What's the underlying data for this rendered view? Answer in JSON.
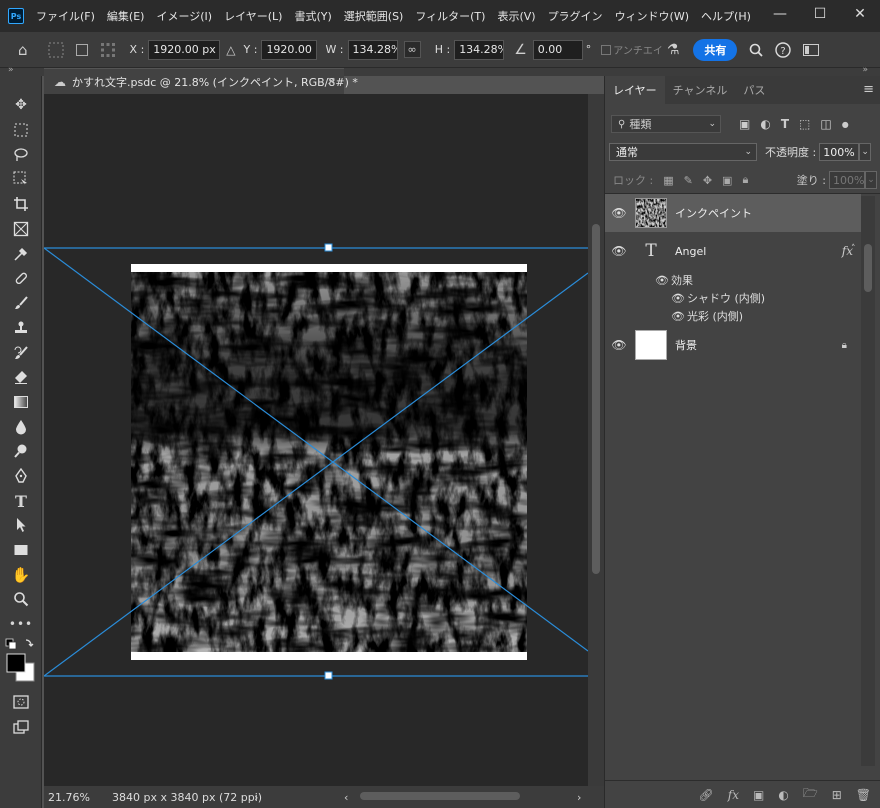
{
  "app": {
    "logo": "Ps",
    "menu": [
      "ファイル(F)",
      "編集(E)",
      "イメージ(I)",
      "レイヤー(L)",
      "書式(Y)",
      "選択範囲(S)",
      "フィルター(T)",
      "表示(V)",
      "プラグイン",
      "ウィンドウ(W)",
      "ヘルプ(H)"
    ],
    "window_controls": [
      "minimize-icon",
      "maximize-icon",
      "close-icon"
    ]
  },
  "options": {
    "x_label": "X :",
    "x_value": "1920.00 px",
    "y_label": "Y :",
    "y_value": "1920.00 px",
    "w_label": "W :",
    "w_value": "134.28%",
    "h_label": "H :",
    "h_value": "134.28%",
    "angle_value": "0.00",
    "angle_unit": "°",
    "antialias_label": "アンチエイ",
    "share_label": "共有"
  },
  "document": {
    "tab_title": "かすれ文字.psdc @ 21.8% (インクペイント, RGB/8#) *",
    "zoom": "21.76%",
    "doc_info": "3840 px x 3840 px (72 ppi)"
  },
  "layers_panel": {
    "tabs": [
      "レイヤー",
      "チャンネル",
      "パス"
    ],
    "active_tab": 0,
    "kind_placeholder": "種類",
    "blend_mode": "通常",
    "opacity_label": "不透明度 :",
    "opacity_value": "100%",
    "lock_label": "ロック :",
    "fill_label": "塗り :",
    "fill_value": "100%",
    "layers": [
      {
        "name": "インクペイント",
        "selected": true,
        "type": "image"
      },
      {
        "name": "Angel",
        "type": "text",
        "fx": "fx"
      },
      {
        "name": "背景",
        "type": "background",
        "locked": true
      }
    ],
    "effects_label": "効果",
    "effects": [
      "シャドウ (内側)",
      "光彩 (内側)"
    ]
  },
  "colors": {
    "accent": "#1473e6",
    "transform_line": "#2a8cd8",
    "selected_layer": "#5d5d5d"
  }
}
